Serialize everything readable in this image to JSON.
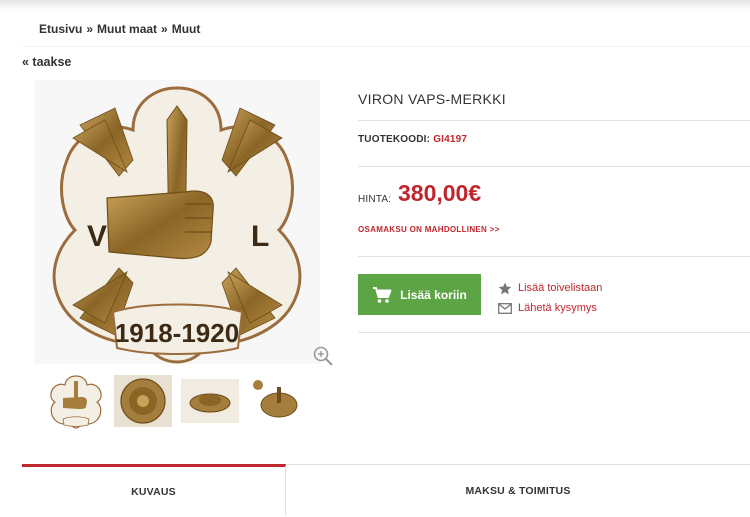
{
  "breadcrumb": {
    "items": [
      "Etusivu",
      "Muut maat",
      "Muut"
    ],
    "separator": "»"
  },
  "back_link": "« taakse",
  "product": {
    "title": "VIRON VAPS-MERKKI",
    "code_label": "TUOTEKOODI:",
    "code_value": "GI4197",
    "price_label": "HINTA:",
    "price": "380,00€",
    "installment_link": "OSAMAKSU ON MAHDOLLINEN >>",
    "add_to_cart": "Lisää koriin",
    "wishlist": "Lisää toivelistaan",
    "ask_question": "Lähetä kysymys"
  },
  "badge_image": {
    "left_letter": "V",
    "right_letter": "L",
    "years": "1918-1920"
  },
  "tabs": [
    {
      "label": "KUVAUS",
      "active": true
    },
    {
      "label": "MAKSU & TOIMITUS",
      "active": false
    }
  ],
  "colors": {
    "accent_red": "#c0262d",
    "cart_green": "#5da544"
  },
  "icons": [
    "zoom-icon",
    "cart-icon",
    "star-icon",
    "envelope-icon"
  ]
}
